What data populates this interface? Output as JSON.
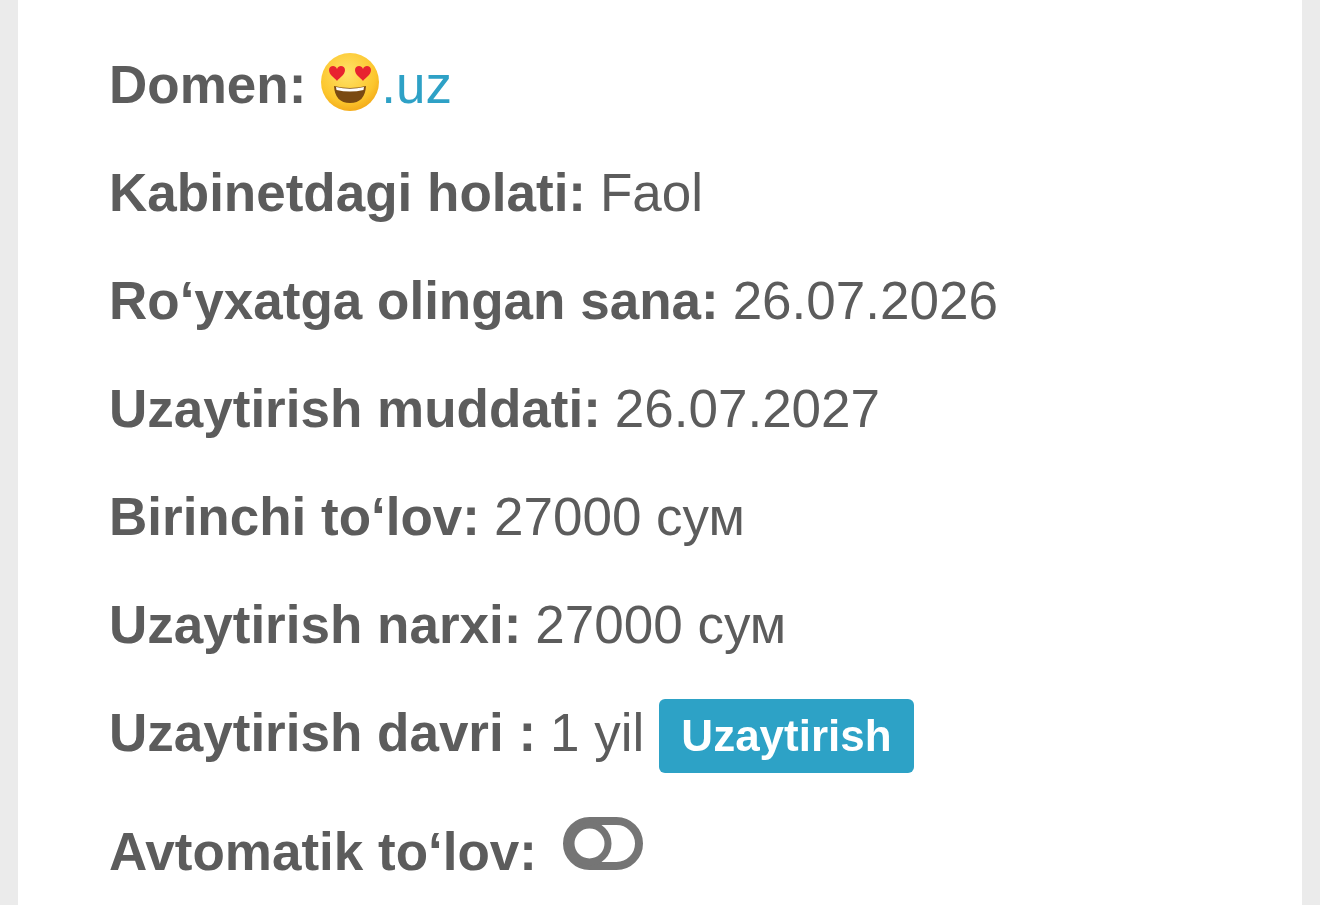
{
  "fields": [
    {
      "kind": "domain",
      "label": "Domen:",
      "value": ".uz"
    },
    {
      "kind": "text",
      "label": "Kabinetdagi holati:",
      "value": "Faol"
    },
    {
      "kind": "text",
      "label": "Roʻyxatga olingan sana:",
      "value": "26.07.2026"
    },
    {
      "kind": "text",
      "label": "Uzaytirish muddati:",
      "value": "26.07.2027"
    },
    {
      "kind": "text",
      "label": "Birinchi toʻlov:",
      "value": "27000 сум"
    },
    {
      "kind": "text",
      "label": "Uzaytirish narxi:",
      "value": "27000 сум"
    },
    {
      "kind": "action",
      "label": "Uzaytirish davri :",
      "value": "1 yil",
      "button": "Uzaytirish"
    },
    {
      "kind": "toggle",
      "label": "Avtomatik toʻlov:",
      "on": false
    }
  ]
}
